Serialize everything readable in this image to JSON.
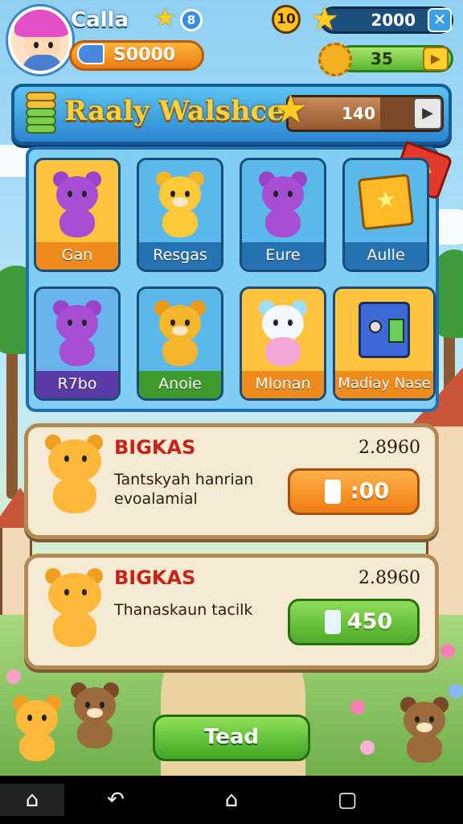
{
  "player": {
    "name": "Calla",
    "level_badge": "8",
    "coins": "S0000"
  },
  "hud": {
    "level": "10",
    "stars": "2000",
    "energy": "35"
  },
  "collection": {
    "title": "Raaly Walshce",
    "progress_value": "140",
    "progress_fraction": 0.6,
    "items": [
      {
        "label": "Gan"
      },
      {
        "label": "Resgas"
      },
      {
        "label": "Eure"
      },
      {
        "label": "Aulle"
      },
      {
        "label": "R7bo"
      },
      {
        "label": "Anoie"
      },
      {
        "label": "Mlonan"
      },
      {
        "label": "Madiay Nase"
      }
    ]
  },
  "deals": [
    {
      "title": "BIGKAS",
      "price": "2.8960",
      "desc": "Tantskyah hanrian evoalamial",
      "button": ":00"
    },
    {
      "title": "BIGKAS",
      "price": "2.8960",
      "desc": "Thanaskaun tacilk",
      "button": "450"
    }
  ],
  "main_button": "Tead",
  "icons": {
    "close": "close-icon",
    "play": "play-icon",
    "nav_home": "home-icon",
    "nav_back": "back-icon",
    "nav_center": "home-outline-icon",
    "nav_recent": "recent-apps-icon"
  },
  "glyphs": {
    "close": "✕",
    "play": "▶",
    "arrow": "▶",
    "back": "↶",
    "home": "⌂",
    "recent": "▢",
    "star": "★"
  }
}
